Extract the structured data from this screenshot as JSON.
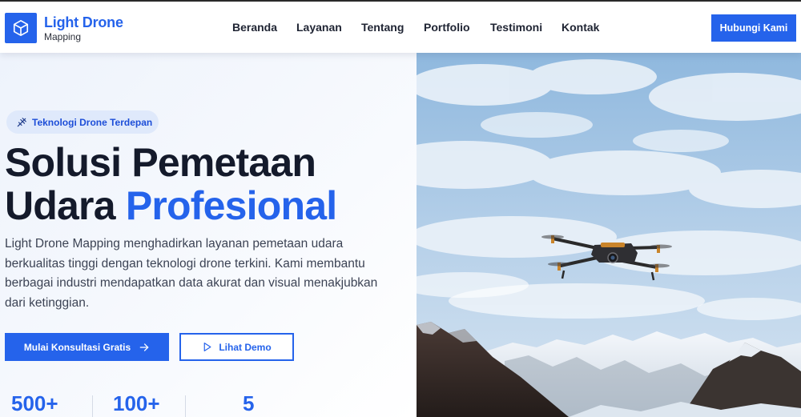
{
  "brand": {
    "title": "Light Drone",
    "subtitle": "Mapping",
    "logo_icon": "cube-icon",
    "accent_color": "#2563eb"
  },
  "nav": {
    "items": [
      {
        "label": "Beranda"
      },
      {
        "label": "Layanan"
      },
      {
        "label": "Tentang"
      },
      {
        "label": "Portfolio"
      },
      {
        "label": "Testimoni"
      },
      {
        "label": "Kontak"
      }
    ],
    "cta_label": "Hubungi Kami"
  },
  "hero": {
    "badge_icon": "drone-icon",
    "badge_text": "Teknologi Drone Terdepan",
    "headline_line1": "Solusi Pemetaan",
    "headline_line2_plain": "Udara",
    "headline_line2_accent": "Profesional",
    "description": "Light Drone Mapping menghadirkan layanan pemetaan udara berkualitas tinggi dengan teknologi drone terkini. Kami membantu berbagai industri mendapatkan data akurat dan visual menakjubkan dari ketinggian.",
    "primary_button": "Mulai Konsultasi Gratis",
    "primary_button_icon": "arrow-right-icon",
    "secondary_button": "Lihat Demo",
    "secondary_button_icon": "play-icon",
    "stats": [
      {
        "value": "500+"
      },
      {
        "value": "100+"
      },
      {
        "value": "5"
      }
    ],
    "image_subject": "drone flying over snowy mountains"
  }
}
